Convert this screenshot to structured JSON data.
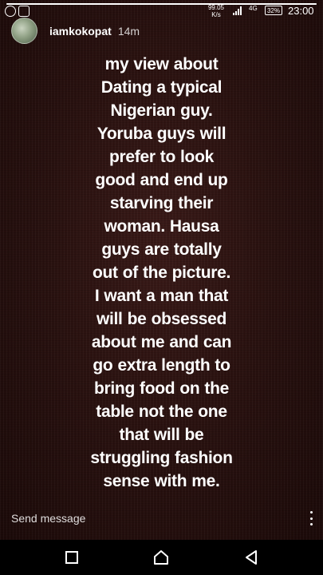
{
  "status_bar": {
    "net_speed_value": "99.05",
    "net_speed_unit": "K/s",
    "network_type": "4G",
    "battery": "32%",
    "time": "23:00",
    "left_icons": [
      "whatsapp-icon",
      "gallery-icon"
    ]
  },
  "story": {
    "progress": 1.0,
    "username": "iamkokopat",
    "timestamp": "14m",
    "lines": [
      "my view about",
      "Dating a typical",
      "Nigerian guy.",
      "Yoruba guys will",
      "prefer to look",
      "good and end up",
      "starving their",
      "woman. Hausa",
      "guys are totally",
      "out of the picture.",
      "I want a man that",
      "will be obsessed",
      "about me and can",
      "go extra length to",
      "bring food on the",
      "table not the one",
      "that will be",
      "struggling fashion",
      "sense with me."
    ]
  },
  "reply": {
    "placeholder": "Send message"
  },
  "nav": {
    "icons": [
      "recent-apps-icon",
      "home-icon",
      "back-icon"
    ]
  },
  "colors": {
    "background": "#2a1210",
    "text": "#ffffff",
    "nav_bar": "#000000"
  }
}
